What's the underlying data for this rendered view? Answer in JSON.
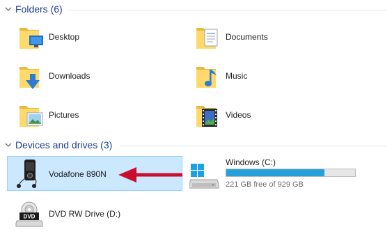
{
  "groups": {
    "folders": {
      "title": "Folders (6)"
    },
    "devices": {
      "title": "Devices and drives (3)"
    }
  },
  "folders": [
    {
      "label": "Desktop",
      "icon": "desktop-folder-icon"
    },
    {
      "label": "Documents",
      "icon": "documents-folder-icon"
    },
    {
      "label": "Downloads",
      "icon": "downloads-folder-icon"
    },
    {
      "label": "Music",
      "icon": "music-folder-icon"
    },
    {
      "label": "Pictures",
      "icon": "pictures-folder-icon"
    },
    {
      "label": "Videos",
      "icon": "videos-folder-icon"
    }
  ],
  "devices": {
    "phone": {
      "label": "Vodafone 890N",
      "icon": "mobile-phone-icon",
      "selected": true
    },
    "windows_drive": {
      "name": "Windows (C:)",
      "free_text": "221 GB free of 929 GB",
      "used_fraction": 0.762,
      "icon": "windows-drive-icon"
    },
    "dvd_drive": {
      "label": "DVD RW Drive (D:)",
      "icon": "dvd-drive-icon"
    }
  },
  "annotation": {
    "icon": "red-arrow-icon",
    "color": "#c8102e"
  },
  "colors": {
    "selection_bg": "#cce8ff",
    "selection_border": "#99d1ff",
    "header_text": "#1f3f8f",
    "storage_bar_fill": "#26a0da",
    "folder_yellow": "#ffd96b"
  }
}
